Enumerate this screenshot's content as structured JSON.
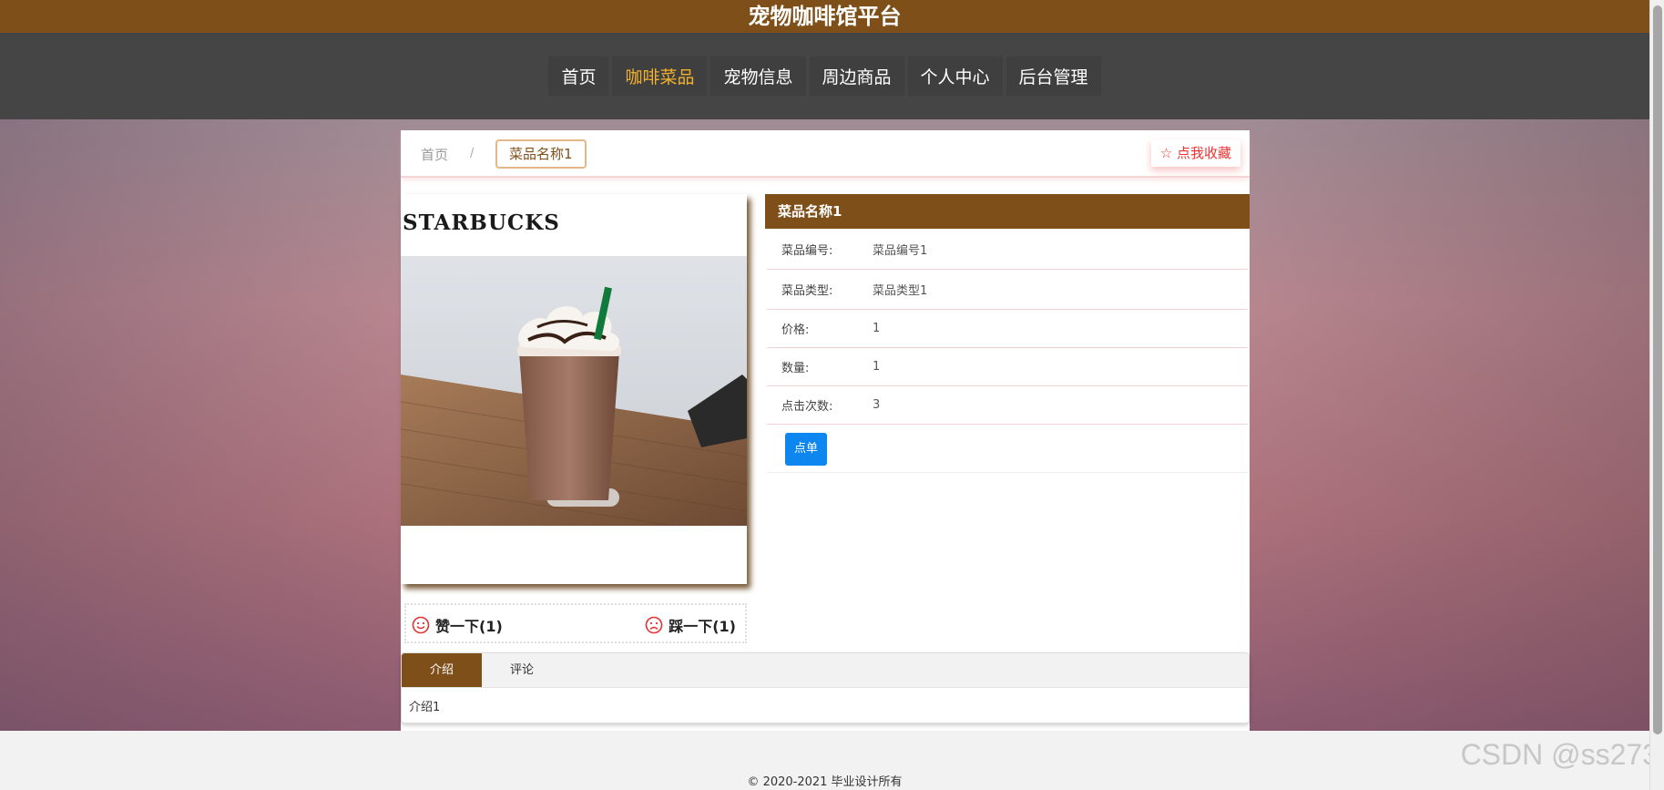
{
  "site": {
    "title": "宠物咖啡馆平台"
  },
  "nav": {
    "items": [
      {
        "label": "首页"
      },
      {
        "label": "咖啡菜品"
      },
      {
        "label": "宠物信息"
      },
      {
        "label": "周边商品"
      },
      {
        "label": "个人中心"
      },
      {
        "label": "后台管理"
      }
    ],
    "active_index": 1
  },
  "breadcrumb": {
    "home": "首页",
    "separator": "/",
    "current": "菜品名称1"
  },
  "favorite": {
    "icon": "star-outline-icon",
    "label": "点我收藏"
  },
  "product": {
    "logo_text": "STARBUCKS",
    "image_name": "chocolate-frappuccino-photo",
    "name": "菜品名称1",
    "fields": [
      {
        "label": "菜品编号:",
        "value": "菜品编号1"
      },
      {
        "label": "菜品类型:",
        "value": "菜品类型1"
      },
      {
        "label": "价格:",
        "value": "1"
      },
      {
        "label": "数量:",
        "value": "1"
      },
      {
        "label": "点击次数:",
        "value": "3"
      }
    ],
    "order_label": "点单"
  },
  "votes": {
    "up_label": "赞一下(1)",
    "up_icon": "smile-icon",
    "down_label": "踩一下(1)",
    "down_icon": "frown-icon"
  },
  "tabs": {
    "items": [
      {
        "label": "介绍"
      },
      {
        "label": "评论"
      }
    ],
    "active_index": 0,
    "content": "介绍1"
  },
  "footer": {
    "copyright": "© 2020-2021 毕业设计所有"
  },
  "watermark": "CSDN @ss273",
  "colors": {
    "brand_brown": "#7f4f1a",
    "nav_dark": "#454545",
    "active_nav": "#f1b12f",
    "order_blue": "#0d86f0",
    "vote_red": "#e33333"
  }
}
